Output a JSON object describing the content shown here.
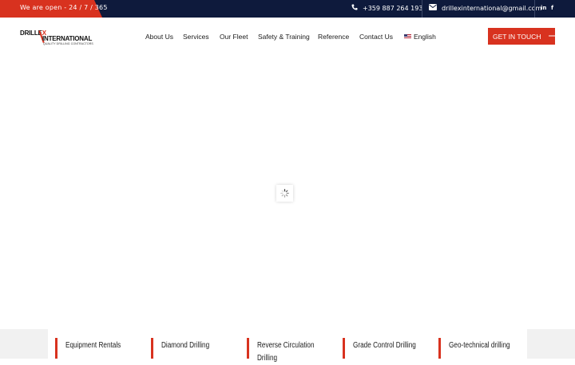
{
  "topbar": {
    "open_text": "We are open - 24 / 7 / 365",
    "phone": "+359 887 264 193",
    "email": "drillexinternational@gmail.com",
    "social": [
      "in",
      "f"
    ],
    "phone_icon": "phone-icon",
    "email_icon": "envelope-icon"
  },
  "header": {
    "logo": {
      "line1_a": "DRILLE",
      "line1_b": "X",
      "line2": "INTERNATIONAL",
      "tagline": "QUALITY DRILLING CONTRACTORS"
    },
    "nav": [
      "About Us",
      "Services",
      "Our Fleet",
      "Safety & Training",
      "Reference",
      "Contact Us"
    ],
    "language": "English",
    "cta": "GET IN TOUCH",
    "cta_arrow": "⟶"
  },
  "services": [
    "Equipment Rentals",
    "Diamond Drilling",
    "Reverse Circulation Drilling",
    "Grade Control Drilling",
    "Geo-technical drilling"
  ],
  "colors": {
    "navy": "#0e1a3c",
    "accent": "#d8321f"
  }
}
